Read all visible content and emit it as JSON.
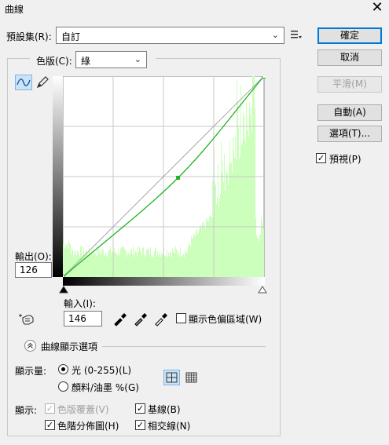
{
  "window": {
    "title": "曲線",
    "close_glyph": "✕"
  },
  "preset": {
    "label": "預設集(R):",
    "value": "自訂"
  },
  "buttons": {
    "ok": "確定",
    "cancel": "取消",
    "smooth": "平滑(M)",
    "auto": "自動(A)",
    "options": "選項(T)..."
  },
  "preview": {
    "label": "預視(P)",
    "checked": true
  },
  "channel": {
    "label": "色版(C):",
    "value": "綠"
  },
  "output": {
    "label": "輸出(O):",
    "value": "126"
  },
  "input": {
    "label": "輸入(I):",
    "value": "146"
  },
  "show_clipping": {
    "label": "顯示色偏區域(W)",
    "checked": false
  },
  "curve_display": {
    "label": "曲線顯示選項"
  },
  "show_amount": {
    "label": "顯示量:",
    "options": [
      {
        "label": "光 (0-255)(L)",
        "selected": true
      },
      {
        "label": "顏料/油墨 %(G)",
        "selected": false
      }
    ]
  },
  "show": {
    "label": "顯示:",
    "items": [
      {
        "label": "色版覆蓋(V)",
        "checked": true,
        "disabled": true
      },
      {
        "label": "基線(B)",
        "checked": true,
        "disabled": false
      },
      {
        "label": "色階分佈圖(H)",
        "checked": true,
        "disabled": false
      },
      {
        "label": "相交線(N)",
        "checked": true,
        "disabled": false
      }
    ]
  },
  "colors": {
    "curve": "#1fb31f",
    "histogram": "#ccffbb",
    "point": "#1fb31f",
    "primary_border": "#0078d7"
  },
  "curve": {
    "control_point": {
      "input": 146,
      "output": 126
    },
    "endpoints": [
      {
        "input": 0,
        "output": 0
      },
      {
        "input": 255,
        "output": 255
      }
    ]
  },
  "icons": {
    "preset_menu": "list-menu-icon",
    "curve_tool": "curve-tool-icon",
    "pencil_tool": "pencil-icon",
    "targeted_adjust": "hand-adjust-icon",
    "black_eyedropper": "eyedropper-black-icon",
    "gray_eyedropper": "eyedropper-gray-icon",
    "white_eyedropper": "eyedropper-white-icon",
    "grid_simple": "grid-4-icon",
    "grid_detailed": "grid-10-icon"
  }
}
